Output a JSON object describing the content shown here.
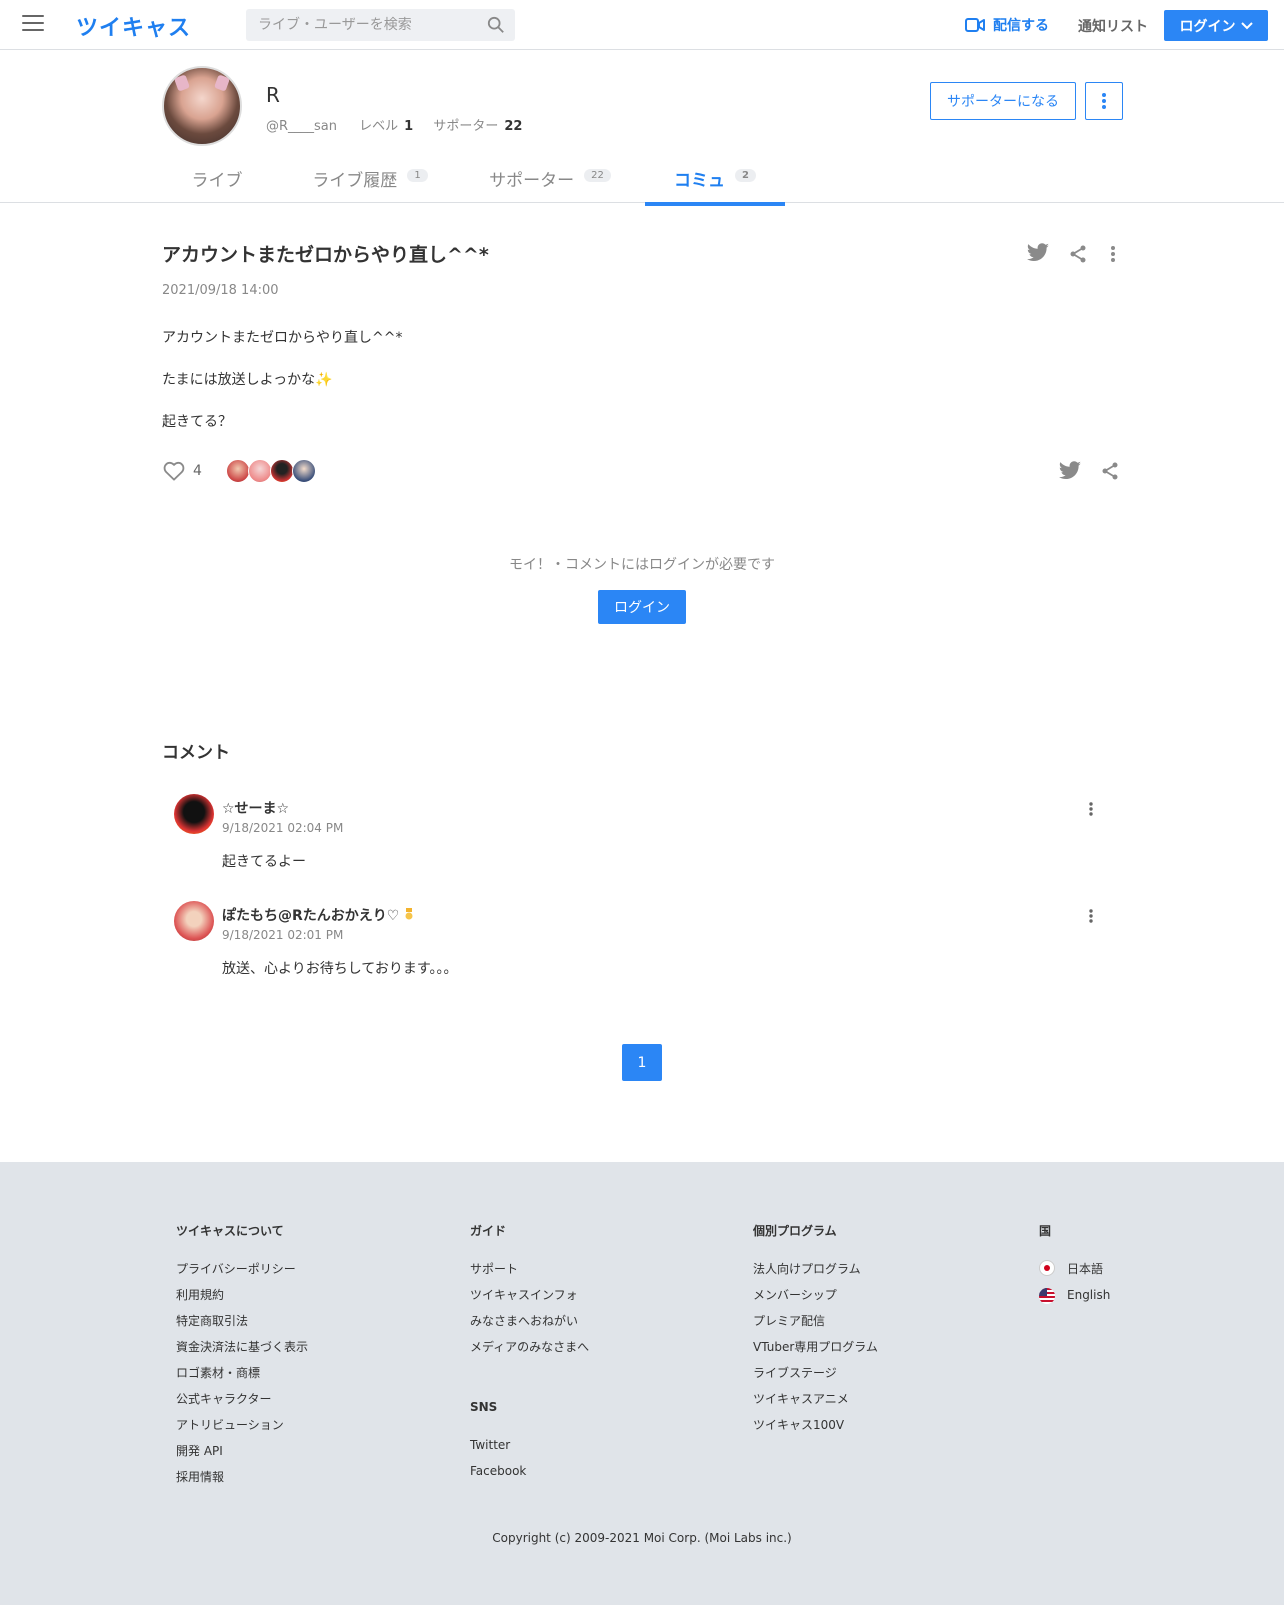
{
  "header": {
    "logo": "ツイキャス",
    "search_placeholder": "ライブ・ユーザーを検索",
    "broadcast_label": "配信する",
    "notification_label": "通知リスト",
    "login_label": "ログイン"
  },
  "profile": {
    "name": "R",
    "handle": "@R____san",
    "level_label": "レベル",
    "level": "1",
    "supporter_label": "サポーター",
    "supporter_count": "22",
    "become_supporter_label": "サポーターになる"
  },
  "tabs": [
    {
      "label": "ライブ",
      "badge": ""
    },
    {
      "label": "ライブ履歴",
      "badge": "1"
    },
    {
      "label": "サポーター",
      "badge": "22"
    },
    {
      "label": "コミュ",
      "badge": "2"
    }
  ],
  "post": {
    "title": "アカウントまたゼロからやり直し^^*",
    "date": "2021/09/18 14:00",
    "lines": [
      "アカウントまたゼロからやり直し^^*",
      "たまには放送しよっかな✨",
      "起きてる？"
    ],
    "like_count": "4"
  },
  "login_prompt": {
    "note": "モイ！・コメントにはログインが必要です",
    "button": "ログイン"
  },
  "comments": {
    "heading": "コメント",
    "items": [
      {
        "name": "☆せーま☆",
        "date": "9/18/2021 02:04 PM",
        "body": "起きてるよー"
      },
      {
        "name": "ぽたもち@Rたんおかえり♡",
        "date": "9/18/2021 02:01 PM",
        "body": "放送、心よりお待ちしております。。。"
      }
    ]
  },
  "pagination": {
    "current": "1"
  },
  "footer": {
    "about": {
      "heading": "ツイキャスについて",
      "links": [
        "プライバシーポリシー",
        "利用規約",
        "特定商取引法",
        "資金決済法に基づく表示",
        "ロゴ素材・商標",
        "公式キャラクター",
        "アトリビューション",
        "開発 API",
        "採用情報"
      ]
    },
    "guide": {
      "heading": "ガイド",
      "links": [
        "サポート",
        "ツイキャスインフォ",
        "みなさまへおねがい",
        "メディアのみなさまへ"
      ]
    },
    "sns": {
      "heading": "SNS",
      "links": [
        "Twitter",
        "Facebook"
      ]
    },
    "programs": {
      "heading": "個別プログラム",
      "links": [
        "法人向けプログラム",
        "メンバーシップ",
        "プレミア配信",
        "VTuber専用プログラム",
        "ライブステージ",
        "ツイキャスアニメ",
        "ツイキャス100V"
      ]
    },
    "country": {
      "heading": "国",
      "links": [
        "日本語",
        "English"
      ]
    },
    "copyright": "Copyright (c) 2009-2021 Moi Corp. (Moi Labs inc.)"
  },
  "colors": {
    "accent": "#2b86f5",
    "footer_bg": "#e0e4e9"
  }
}
